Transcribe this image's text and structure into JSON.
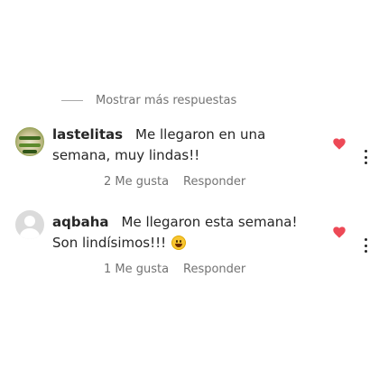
{
  "show_more": {
    "label": "Mostrar más respuestas"
  },
  "comments": [
    {
      "username": "lastelitas",
      "text": "Me llegaron en una semana, muy lindas!!",
      "likes_label": "2 Me gusta",
      "reply_label": "Responder",
      "avatar_icon": "shop-logo-avatar",
      "liked": true
    },
    {
      "username": "aqbaha",
      "text": "Me llegaron esta semana! Son lindísimos!!!",
      "emoji": "grinning-face",
      "likes_label": "1 Me gusta",
      "reply_label": "Responder",
      "avatar_icon": "default-profile-avatar",
      "liked": true
    }
  ],
  "colors": {
    "heart": "#ed4956",
    "text": "#262626",
    "secondary": "#737373"
  }
}
